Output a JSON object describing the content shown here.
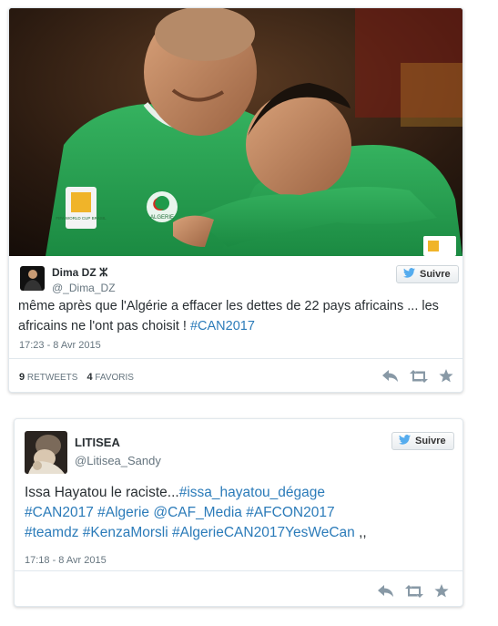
{
  "tweets": [
    {
      "display_name": "Dima DZ ⵣ",
      "handle": "@_Dima_DZ",
      "follow_label": "Suivre",
      "text_parts": [
        "même après que l'Algérie a effacer les dettes de 22 pays africains ... les africains ne l'ont pas choisit ! ",
        "#CAN2017"
      ],
      "timestamp": "17:23 - 8 Avr 2015",
      "retweets_count": "9",
      "retweets_label": "RETWEETS",
      "favorites_count": "4",
      "favorites_label": "FAVORIS"
    },
    {
      "display_name": "LITISEA",
      "handle": "@Litisea_Sandy",
      "follow_label": "Suivre",
      "text_parts": [
        "Issa Hayatou le raciste...",
        "#issa_hayatou_dégage",
        "#CAN2017",
        "#Algerie",
        "@CAF_Media",
        "#AFCON2017",
        "#teamdz",
        "#KenzaMorsli",
        "#AlgerieCAN2017YesWeCan",
        ",,"
      ],
      "timestamp": "17:18 - 8 Avr 2015"
    }
  ],
  "photo_texts": {
    "badge_cup": "FIFA WORLD CUP BRASIL",
    "jersey_crest": "ALGERIE"
  },
  "colors": {
    "link": "#2b7bb9",
    "text": "#292f33",
    "muted": "#66757f",
    "twitter_blue": "#55acee",
    "jersey_green": "#1f9a4a",
    "icon_grey": "#aab8c2"
  },
  "icons": [
    "twitter-bird-icon",
    "reply-icon",
    "retweet-icon",
    "favorite-star-icon"
  ]
}
